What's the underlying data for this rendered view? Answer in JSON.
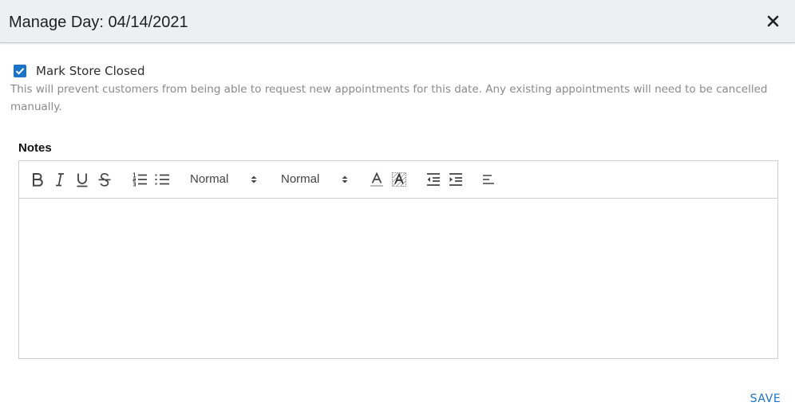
{
  "dialog": {
    "title": "Manage Day: 04/14/2021"
  },
  "mark_store_closed": {
    "checked": true,
    "label": "Mark Store Closed",
    "helper_text": "This will prevent customers from being able to request new appointments for this date. Any existing appointments will need to be cancelled manually."
  },
  "notes": {
    "label": "Notes",
    "toolbar": {
      "buttons": [
        "bold-icon",
        "italic-icon",
        "underline-icon",
        "strikethrough-icon",
        "ordered-list-icon",
        "bullet-list-icon",
        "text-color-icon",
        "background-color-icon",
        "outdent-icon",
        "indent-icon",
        "align-left-icon"
      ],
      "header_picker": "Normal",
      "size_picker": "Normal"
    },
    "content": ""
  },
  "actions": {
    "save_label": "SAVE"
  },
  "colors": {
    "accent": "#1a73c8",
    "header_bg": "#eeeff1",
    "helper_text": "#8a8a8a",
    "border": "#cfcfcf"
  }
}
